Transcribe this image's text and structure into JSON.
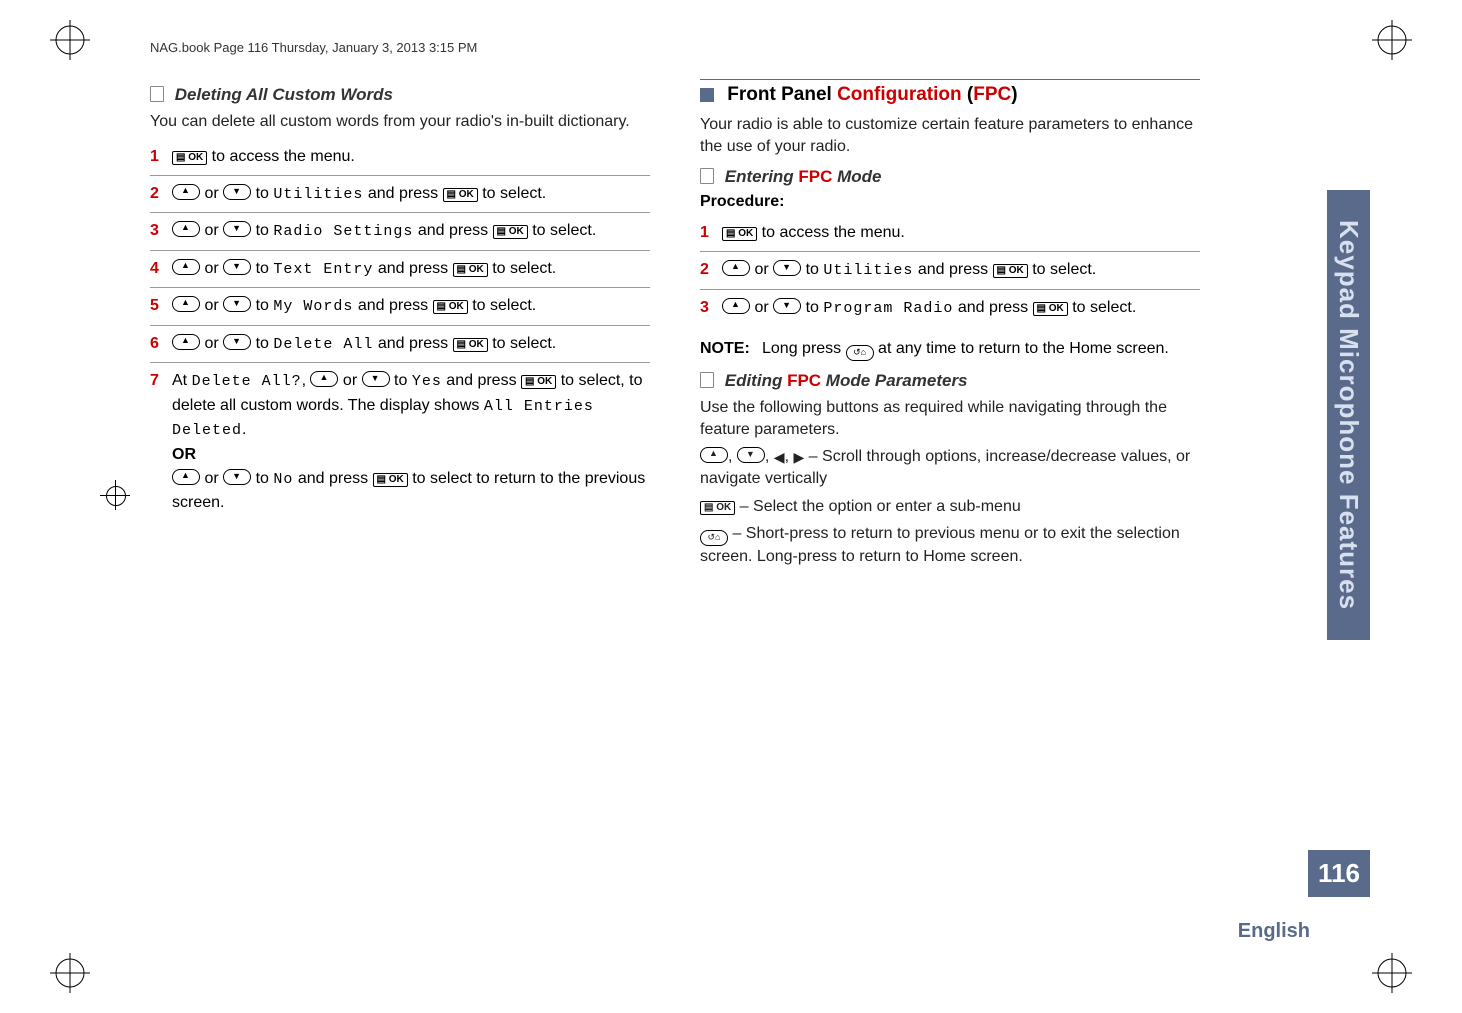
{
  "header": "NAG.book  Page 116  Thursday, January 3, 2013  3:15 PM",
  "side_tab": "Keypad Microphone Features",
  "page_number": "116",
  "language": "English",
  "left": {
    "h_sub": "Deleting All Custom Words",
    "intro": "You can delete all custom words from your radio's in-built dictionary.",
    "steps": {
      "s1_a": " to access the menu.",
      "s2_a": " or ",
      "s2_b": " to ",
      "s2_menu": "Utilities",
      "s2_c": " and press ",
      "s2_d": " to select.",
      "s3_a": " or ",
      "s3_b": " to ",
      "s3_menu": "Radio Settings",
      "s3_c": " and press ",
      "s3_d": " to select.",
      "s4_a": " or ",
      "s4_b": " to ",
      "s4_menu": "Text Entry",
      "s4_c": " and press ",
      "s4_d": " to select.",
      "s5_a": " or ",
      "s5_b": " to ",
      "s5_menu": "My Words",
      "s5_c": " and press ",
      "s5_d": " to select.",
      "s6_a": " or ",
      "s6_b": " to ",
      "s6_menu": "Delete All",
      "s6_c": " and press ",
      "s6_d": " to select.",
      "s7_pre": "At ",
      "s7_q": "Delete All?",
      "s7_a": ", ",
      "s7_or": " or ",
      "s7_b": " to ",
      "s7_yes": "Yes",
      "s7_c": " and press ",
      "s7_d": " to select, to delete all custom words. The display shows ",
      "s7_msg": "All Entries Deleted",
      "s7_dot": ".",
      "or": "OR",
      "s7_e": " or ",
      "s7_f": " to ",
      "s7_no": "No",
      "s7_g": " and press ",
      "s7_h": " to select to return to the previous screen."
    }
  },
  "right": {
    "h_main_a": "Front Panel ",
    "h_main_red": "Configuration",
    "h_main_b": " (",
    "h_main_red2": "FPC",
    "h_main_c": ")",
    "intro": "Your radio is able to customize certain feature parameters to enhance the use of your radio.",
    "h_sub1_a": "Entering ",
    "h_sub1_red": "FPC",
    "h_sub1_b": " Mode",
    "proc": "Procedure:",
    "steps": {
      "s1_a": " to access the menu.",
      "s2_a": " or ",
      "s2_b": " to ",
      "s2_menu": "Utilities",
      "s2_c": " and press ",
      "s2_d": " to select.",
      "s3_a": " or ",
      "s3_b": " to ",
      "s3_menu": "Program Radio",
      "s3_c": " and press ",
      "s3_d": " to select."
    },
    "note_label": "NOTE:",
    "note_a": "Long press ",
    "note_b": " at any time to return to the Home screen.",
    "h_sub2_a": "Editing ",
    "h_sub2_red": "FPC",
    "h_sub2_b": " Mode Parameters",
    "edit_intro": "Use the following buttons as required while navigating through the feature parameters.",
    "line1_a": ", ",
    "line1_b": ", ",
    "line1_c": ", ",
    "line1_d": " – Scroll through options, increase/decrease values, or navigate vertically",
    "line2": " – Select the option or enter a sub-menu",
    "line3": " – Short-press to return to previous menu or to exit the selection screen. Long-press to return to Home screen."
  }
}
